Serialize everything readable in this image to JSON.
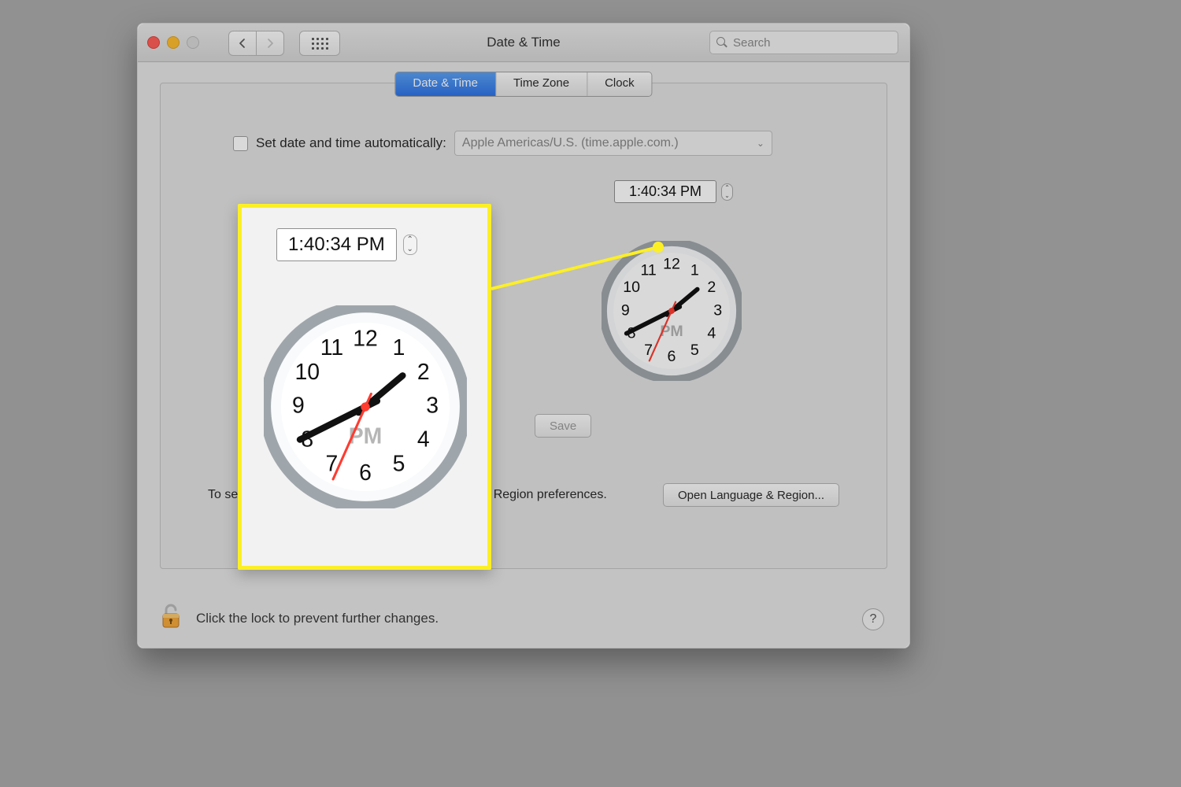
{
  "window": {
    "title": "Date & Time"
  },
  "search": {
    "placeholder": "Search"
  },
  "tabs": [
    {
      "label": "Date & Time",
      "active": true
    },
    {
      "label": "Time Zone",
      "active": false
    },
    {
      "label": "Clock",
      "active": false
    }
  ],
  "auto": {
    "checkbox_label": "Set date and time automatically:",
    "server": "Apple Americas/U.S. (time.apple.com.)",
    "checked": false
  },
  "time": {
    "display": "1:40:34 PM",
    "ampm": "PM",
    "hour": 1,
    "minute": 40,
    "second": 34
  },
  "buttons": {
    "save": "Save",
    "open_lang_region": "Open Language & Region..."
  },
  "footer": {
    "format_hint_left": "To set",
    "format_hint_right": "Region preferences."
  },
  "lock": {
    "text": "Click the lock to prevent further changes."
  },
  "help": {
    "label": "?"
  },
  "clock_numbers": [
    "12",
    "1",
    "2",
    "3",
    "4",
    "5",
    "6",
    "7",
    "8",
    "9",
    "10",
    "11"
  ]
}
